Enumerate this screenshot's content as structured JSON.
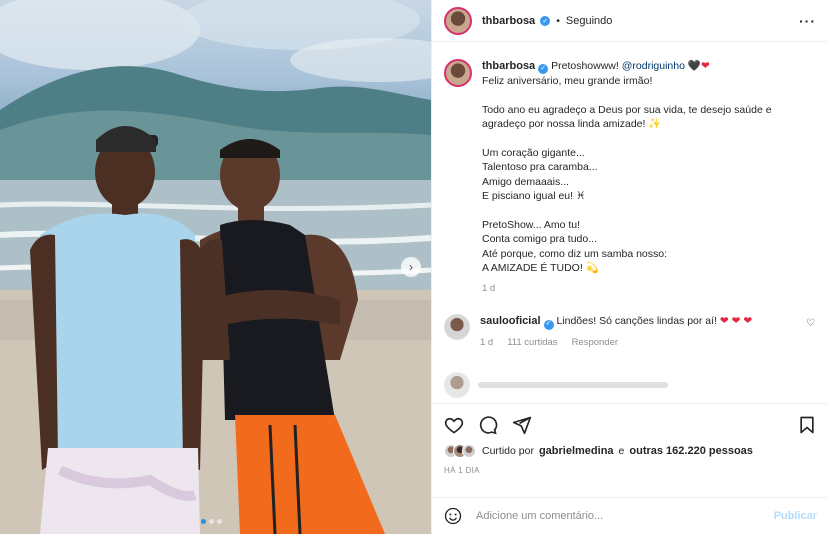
{
  "post": {
    "username": "thbarbosa",
    "follow_status": "Seguindo",
    "carousel_dots": 3
  },
  "caption": {
    "username": "thbarbosa",
    "lines": [
      "Pretoshowww!",
      "@rodriguinho",
      "Feliz aniversário, meu grande irmão!",
      "Todo ano eu agradeço a Deus por sua vida, te desejo saúde e",
      "agradeço por nossa linda amizade! ✨",
      "Um coração gigante...",
      "Talentoso pra caramba...",
      "Amigo demaaais...",
      "E pisciano igual eu! ♓",
      "PretoShow... Amo tu!",
      "Conta comigo pra tudo...",
      "Até porque, como diz um samba nosso:",
      "A AMIZADE É TUDO! 💫"
    ],
    "time": "1 d"
  },
  "comment": {
    "username": "saulooficial",
    "text": "Lindões! Só canções lindas por aí!",
    "time": "1 d",
    "likes": "111 curtidas",
    "reply": "Responder"
  },
  "likes": {
    "prefix": "Curtido por",
    "user": "gabrielmedina",
    "middle": "e",
    "others": "outras 162.220 pessoas"
  },
  "timestamp": "HÁ 1 DIA",
  "composer": {
    "placeholder": "Adicione um comentário...",
    "publish": "Publicar"
  },
  "icons": {
    "more": "more-icon",
    "like": "heart-icon",
    "comment": "comment-icon",
    "share": "share-icon",
    "save": "bookmark-icon",
    "emoji": "emoji-icon",
    "next": "chevron-right-icon"
  }
}
